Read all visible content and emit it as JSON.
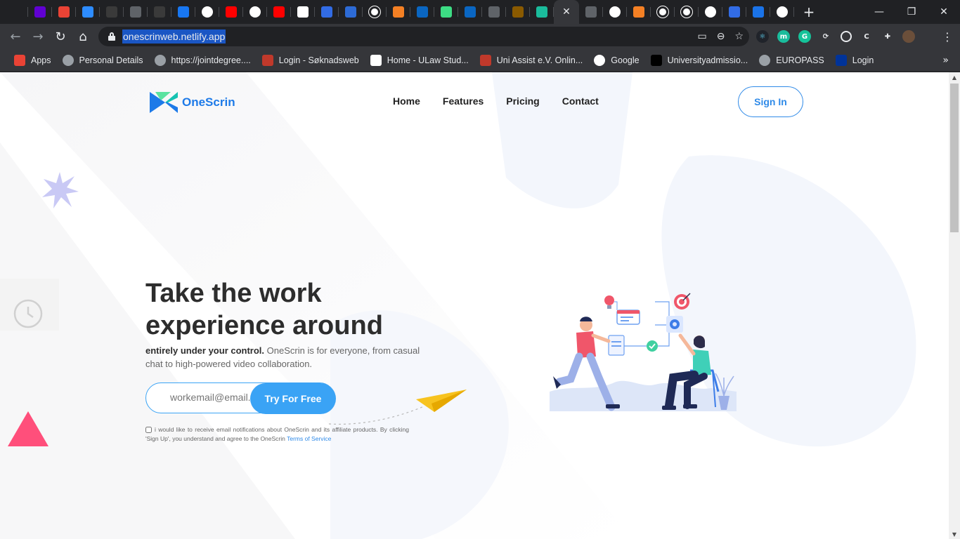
{
  "browser": {
    "tabs": [
      {
        "icon": "history-icon",
        "color": "#202124"
      },
      {
        "icon": "yahoo-mail-icon",
        "color": "#6001d2"
      },
      {
        "icon": "gmail-icon",
        "color": "#ea4335"
      },
      {
        "icon": "zoom-icon",
        "color": "#2d8cff"
      },
      {
        "icon": "css-icon",
        "color": "#3a3a3a",
        "text": "css"
      },
      {
        "icon": "globe-icon",
        "color": "#5f6368"
      },
      {
        "icon": "dark-page-icon",
        "color": "#3a3a3a"
      },
      {
        "icon": "facebook-icon",
        "color": "#1877f2",
        "text": "f"
      },
      {
        "icon": "google-icon",
        "color": "#ffffff",
        "text": "G"
      },
      {
        "icon": "youtube-icon",
        "color": "#ff0000"
      },
      {
        "icon": "google-icon",
        "color": "#ffffff",
        "text": "G"
      },
      {
        "icon": "youtube-icon",
        "color": "#ff0000"
      },
      {
        "icon": "udemy-icon",
        "color": "#ffffff"
      },
      {
        "icon": "kubernetes-icon",
        "color": "#326ce5"
      },
      {
        "icon": "gear-blue-icon",
        "color": "#2d6bd6"
      },
      {
        "icon": "github-icon",
        "color": "#ffffff"
      },
      {
        "icon": "stackoverflow-icon",
        "color": "#f48024"
      },
      {
        "icon": "linkedin-icon",
        "color": "#0a66c2",
        "text": "in"
      },
      {
        "icon": "android-icon",
        "color": "#3ddc84"
      },
      {
        "icon": "linkedin-icon",
        "color": "#0a66c2",
        "text": "in"
      },
      {
        "icon": "globe-icon",
        "color": "#5f6368"
      },
      {
        "icon": "bitcoin-icon",
        "color": "#8a5a00"
      },
      {
        "icon": "diamond-icon",
        "color": "#1abc9c"
      },
      {
        "icon": "close-icon",
        "active": true
      },
      {
        "icon": "crown-icon",
        "color": "#5f6368"
      },
      {
        "icon": "google-icon",
        "color": "#ffffff",
        "text": "G"
      },
      {
        "icon": "stackoverflow-icon",
        "color": "#f48024"
      },
      {
        "icon": "github-icon",
        "color": "#ffffff"
      },
      {
        "icon": "github-icon",
        "color": "#ffffff"
      },
      {
        "icon": "google-icon",
        "color": "#ffffff",
        "text": "G"
      },
      {
        "icon": "kubernetes-icon",
        "color": "#326ce5"
      },
      {
        "icon": "translate-icon",
        "color": "#1a73e8"
      },
      {
        "icon": "google-icon",
        "color": "#ffffff",
        "text": "G"
      }
    ],
    "url": "onescrinweb.netlify.app",
    "bookmarks": [
      {
        "label": "Apps",
        "icon": "apps-grid-icon",
        "color": "#ea4335"
      },
      {
        "label": "Personal Details",
        "icon": "globe-icon",
        "color": "#9aa0a6"
      },
      {
        "label": "https://jointdegree....",
        "icon": "globe-icon",
        "color": "#9aa0a6"
      },
      {
        "label": "Login - Søknadsweb",
        "icon": "soknadsweb-icon",
        "color": "#c0392b"
      },
      {
        "label": "Home - ULaw Stud...",
        "icon": "ulaw-icon",
        "color": "#ffffff"
      },
      {
        "label": "Uni Assist e.V. Onlin...",
        "icon": "uni-assist-icon",
        "color": "#c0392b"
      },
      {
        "label": "Google",
        "icon": "google-icon",
        "color": "#ffffff"
      },
      {
        "label": "Universityadmissio...",
        "icon": "universityadmissions-icon",
        "color": "#000000"
      },
      {
        "label": "EUROPASS",
        "icon": "globe-icon",
        "color": "#9aa0a6"
      },
      {
        "label": "Login",
        "icon": "eu-flag-icon",
        "color": "#003399"
      }
    ]
  },
  "site": {
    "brand": "OneScrin",
    "nav": [
      "Home",
      "Features",
      "Pricing",
      "Contact"
    ],
    "signin": "Sign In",
    "hero": {
      "title_line1": "Take the work",
      "title_line2": "experience around",
      "desc_bold": "entirely under your control.",
      "desc_rest": " OneScrin is for everyone, from casual chat to high-powered video collaboration.",
      "email_placeholder": "workemail@email.c",
      "cta": "Try For Free",
      "consent_text": "i would like to receive email notifications about OneScrin and its affiliate products. By clicking 'Sign Up', you understand and agree to the OneScrin ",
      "tos_link": "Terms of Service"
    },
    "colors": {
      "accent": "#3aa3f5",
      "brand_blue": "#1d7ae8",
      "triangle": "#ff4f7b",
      "plane": "#f7c31f"
    }
  }
}
